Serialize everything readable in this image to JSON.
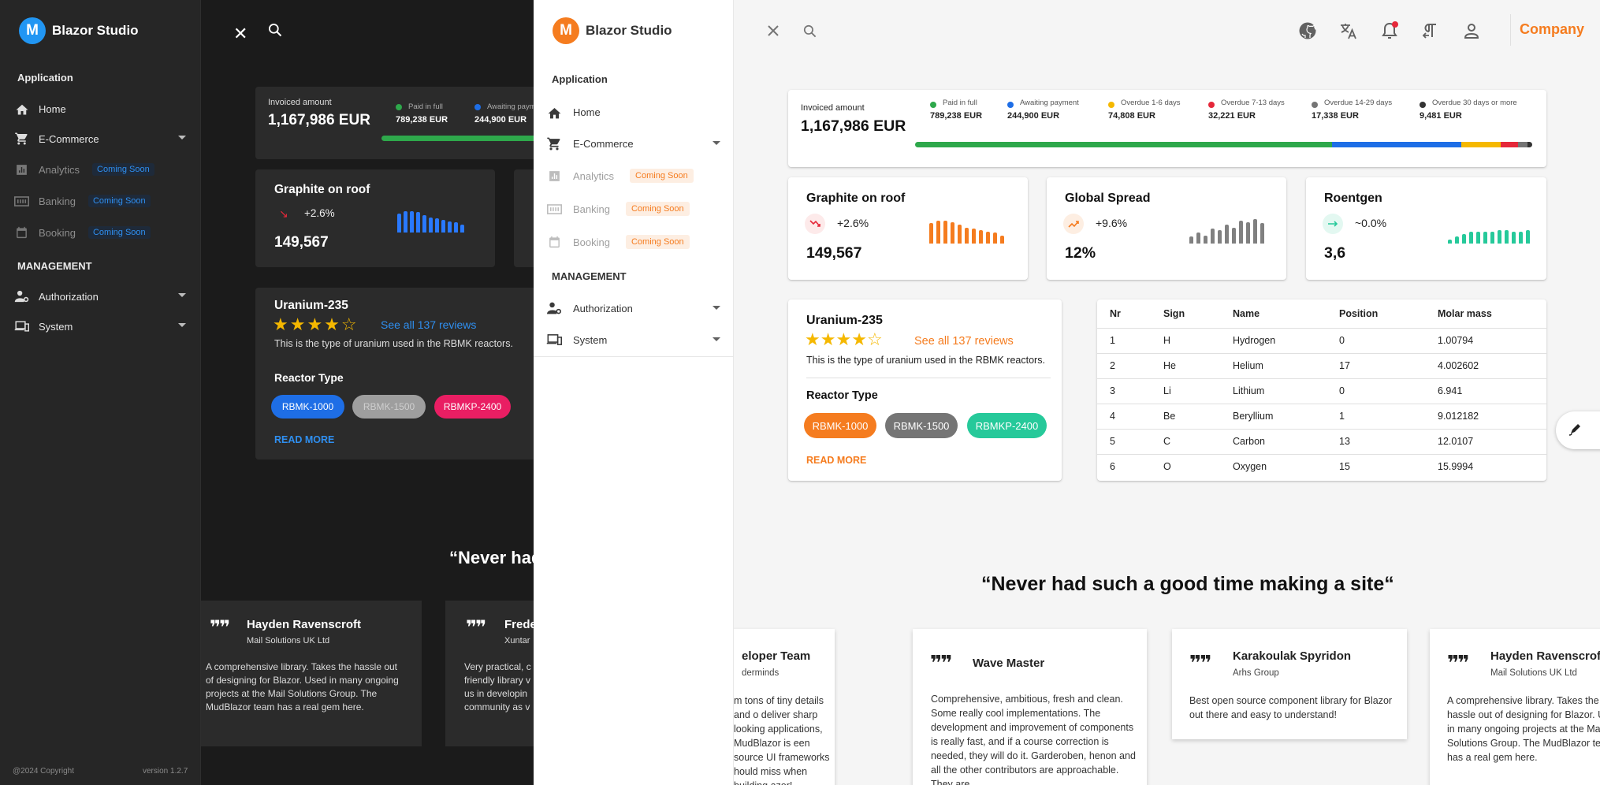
{
  "dark": {
    "brand": "Blazor Studio",
    "section_application": "Application",
    "section_management": "MANAGEMENT",
    "nav": [
      {
        "label": "Home",
        "soon": ""
      },
      {
        "label": "E-Commerce",
        "soon": ""
      },
      {
        "label": "Analytics",
        "soon": "Coming Soon"
      },
      {
        "label": "Banking",
        "soon": "Coming Soon"
      },
      {
        "label": "Booking",
        "soon": "Coming Soon"
      },
      {
        "label": "Authorization",
        "soon": ""
      },
      {
        "label": "System",
        "soon": ""
      }
    ],
    "footer_copyright": "@2024 Copyright",
    "footer_version": "version 1.2.7",
    "invoiced_label": "Invoiced amount",
    "invoiced_amount": "1,167,986 EUR",
    "paid_label": "Paid in full",
    "paid_value": "789,238 EUR",
    "await_label": "Awaiting paym",
    "await_value": "244,900 EUR",
    "graphite_title": "Graphite on roof",
    "graphite_change": "+2.6%",
    "graphite_value": "149,567",
    "uranium_title": "Uranium-235",
    "reviews_link": "See all 137 reviews",
    "uranium_desc": "This is the type of uranium used in the RBMK reactors.",
    "reactor_type": "Reactor Type",
    "chips": [
      "RBMK-1000",
      "RBMK-1500",
      "RBMKP-2400"
    ],
    "read_more": "READ MORE",
    "quote": "“Never had",
    "testimonials": [
      {
        "name": "Hayden Ravenscroft",
        "company": "Mail Solutions UK Ltd",
        "text": "A comprehensive library. Takes the hassle out of designing for Blazor. Used in many ongoing projects at the Mail Solutions Group. The MudBlazor team has a real gem here."
      },
      {
        "name": "Frede",
        "company": "Xuntar",
        "text": "Very practical, c friendly library v us in developin community as v"
      }
    ]
  },
  "light_nav": {
    "brand": "Blazor Studio",
    "section_application": "Application",
    "section_management": "MANAGEMENT",
    "items": [
      {
        "label": "Home",
        "soon": ""
      },
      {
        "label": "E-Commerce",
        "soon": ""
      },
      {
        "label": "Analytics",
        "soon": "Coming Soon"
      },
      {
        "label": "Banking",
        "soon": "Coming Soon"
      },
      {
        "label": "Booking",
        "soon": "Coming Soon"
      },
      {
        "label": "Authorization",
        "soon": ""
      },
      {
        "label": "System",
        "soon": ""
      }
    ]
  },
  "topbar": {
    "company": "Company",
    "icons": [
      "close-icon",
      "search-icon",
      "github-icon",
      "translate-icon",
      "notifications-icon",
      "text-direction-icon",
      "account-icon"
    ]
  },
  "invoice": {
    "label": "Invoiced amount",
    "amount": "1,167,986 EUR",
    "legend": [
      {
        "label": "Paid in full",
        "value": "789,238 EUR",
        "color": "#2ea84b"
      },
      {
        "label": "Awaiting payment",
        "value": "244,900 EUR",
        "color": "#1e6ee6"
      },
      {
        "label": "Overdue 1-6 days",
        "value": "74,808 EUR",
        "color": "#f5b800"
      },
      {
        "label": "Overdue 7-13 days",
        "value": "32,221 EUR",
        "color": "#e5283a"
      },
      {
        "label": "Overdue 14-29 days",
        "value": "17,338 EUR",
        "color": "#757575"
      },
      {
        "label": "Overdue 30 days or more",
        "value": "9,481 EUR",
        "color": "#333333"
      }
    ],
    "shares": [
      789238,
      244900,
      74808,
      32221,
      17338,
      9481
    ]
  },
  "stats": [
    {
      "title": "Graphite on roof",
      "change": "+2.6%",
      "value": "149,567",
      "trend": "down",
      "color": "#f57c1f",
      "bars": [
        0.75,
        0.85,
        0.85,
        0.8,
        0.7,
        0.6,
        0.55,
        0.5,
        0.45,
        0.4,
        0.3
      ]
    },
    {
      "title": "Global Spread",
      "change": "+9.6%",
      "value": "12%",
      "trend": "up",
      "color": "#808080",
      "bars": [
        0.25,
        0.4,
        0.3,
        0.55,
        0.5,
        0.7,
        0.6,
        0.85,
        0.8,
        0.9,
        0.75
      ]
    },
    {
      "title": "Roentgen",
      "change": "~0.0%",
      "value": "3,6",
      "trend": "flat",
      "color": "#26c99a",
      "bars": [
        0.15,
        0.25,
        0.35,
        0.45,
        0.45,
        0.45,
        0.45,
        0.5,
        0.5,
        0.45,
        0.45,
        0.5
      ]
    }
  ],
  "uranium": {
    "title": "Uranium-235",
    "rating": 4,
    "reviews_link": "See all 137 reviews",
    "description": "This is the type of uranium used in the RBMK reactors.",
    "reactor_type": "Reactor Type",
    "chips": [
      "RBMK-1000",
      "RBMK-1500",
      "RBMKP-2400"
    ],
    "read_more": "READ MORE"
  },
  "elements": {
    "headers": [
      "Nr",
      "Sign",
      "Name",
      "Position",
      "Molar mass"
    ],
    "rows": [
      [
        "1",
        "H",
        "Hydrogen",
        "0",
        "1.00794"
      ],
      [
        "2",
        "He",
        "Helium",
        "17",
        "4.002602"
      ],
      [
        "3",
        "Li",
        "Lithium",
        "0",
        "6.941"
      ],
      [
        "4",
        "Be",
        "Beryllium",
        "1",
        "9.012182"
      ],
      [
        "5",
        "C",
        "Carbon",
        "13",
        "12.0107"
      ],
      [
        "6",
        "O",
        "Oxygen",
        "15",
        "15.9994"
      ]
    ]
  },
  "quote": "“Never had such a good time making a site“",
  "testimonials": [
    {
      "name": "eloper Team",
      "company": "derminds",
      "text": "m tons of tiny details and o deliver sharp looking applications, MudBlazor is een source UI frameworks hould miss when building azor!"
    },
    {
      "name": "Wave Master",
      "company": "",
      "text": "Comprehensive, ambitious, fresh and clean. Some really cool implementations. The development and improvement of components is really fast, and if a course correction is needed, they will do it. Garderoben, henon and all the other contributors are approachable. They are"
    },
    {
      "name": "Karakoulak Spyridon",
      "company": "Arhs Group",
      "text": "Best open source component library for Blazor out there and easy to understand!"
    },
    {
      "name": "Hayden Ravenscroft",
      "company": "Mail Solutions UK Ltd",
      "text": "A comprehensive library. Takes the hassle out of designing for Blazor. Used in many ongoing projects at the Mail Solutions Group. The MudBlazor team has a real gem here."
    }
  ]
}
